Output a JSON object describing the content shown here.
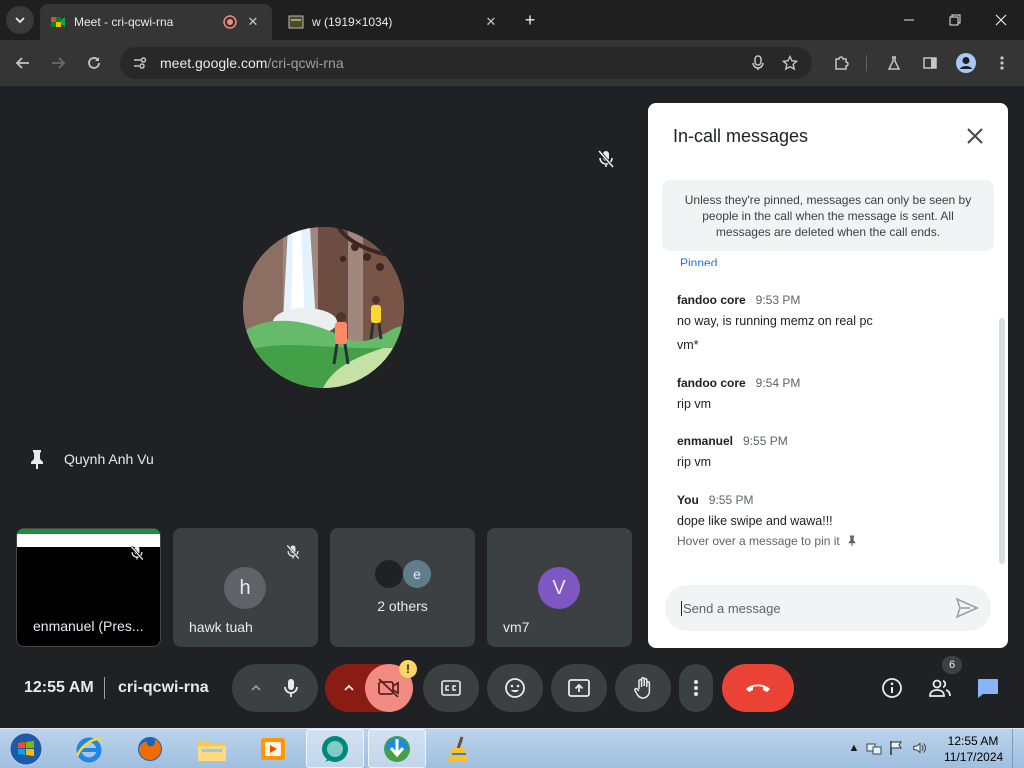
{
  "browser": {
    "tabs": [
      {
        "title": "Meet - cri-qcwi-rna",
        "active": true,
        "recording": true
      },
      {
        "title": "w (1919×1034)",
        "active": false
      }
    ],
    "new_tab": "+",
    "url_domain": "meet.google.com",
    "url_path": "/cri-qcwi-rna"
  },
  "meeting": {
    "pinned_name": "Quynh Anh Vu",
    "tiles": [
      {
        "name": "enmanuel (Pres...",
        "initial": ""
      },
      {
        "name": "hawk tuah",
        "initial": "h"
      },
      {
        "name": "2 others",
        "initial": "e"
      },
      {
        "name": "vm7",
        "initial": "V"
      }
    ],
    "clock": "12:55 AM",
    "code": "cri-qcwi-rna",
    "warn_badge": "!",
    "people_count": "6"
  },
  "chat": {
    "title": "In-call messages",
    "notice": "Unless they're pinned, messages can only be seen by people in the call when the message is sent. All messages are deleted when the call ends.",
    "pinned_stub": "Pinned",
    "messages": [
      {
        "sender": "fandoo core",
        "time": "9:53 PM",
        "lines": [
          "no way, is running memz on real pc",
          "vm*"
        ]
      },
      {
        "sender": "fandoo core",
        "time": "9:54 PM",
        "lines": [
          "rip vm"
        ]
      },
      {
        "sender": "enmanuel",
        "time": "9:55 PM",
        "lines": [
          "rip vm"
        ]
      },
      {
        "sender": "You",
        "time": "9:55 PM",
        "lines": [
          "dope like swipe and wawa!!!"
        ]
      }
    ],
    "hover_hint": "Hover over a message to pin it",
    "input_placeholder": "Send a message"
  },
  "taskbar": {
    "time": "12:55 AM",
    "date": "11/17/2024"
  },
  "colors": {
    "meet_bg": "#202124",
    "end_call": "#ea4335",
    "cam_off": "#f28b82",
    "accent": "#1a73e8"
  }
}
